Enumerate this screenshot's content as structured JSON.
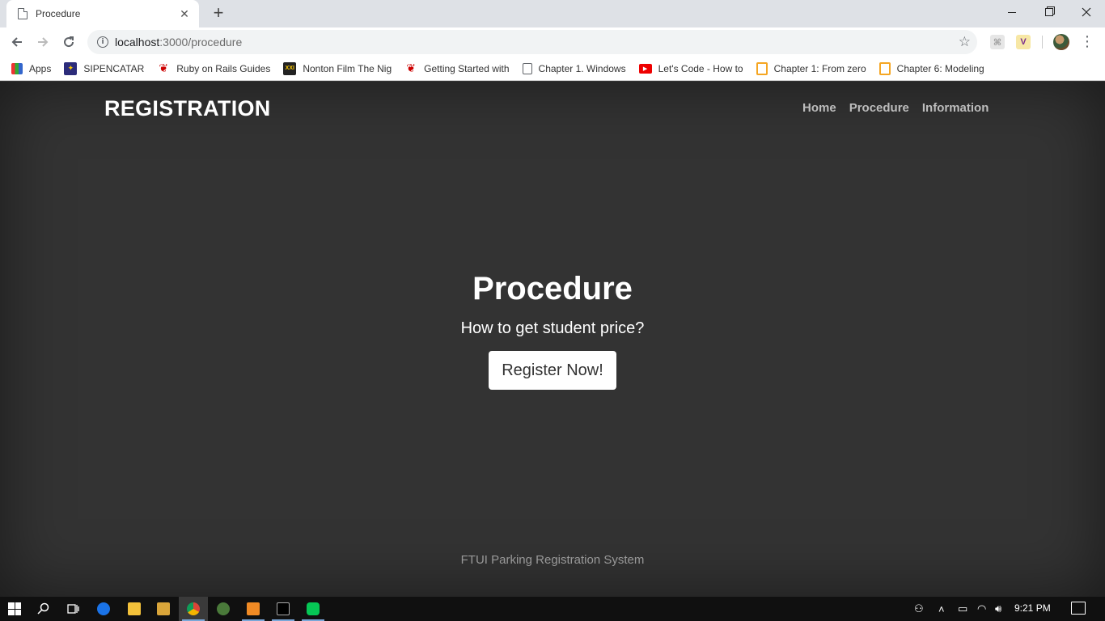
{
  "browser": {
    "tab_title": "Procedure",
    "tab_close": "✕",
    "new_tab": "+",
    "url_host": "localhost",
    "url_path": ":3000/procedure",
    "bookmarks": [
      {
        "label": "Apps",
        "icon": "apps-icon"
      },
      {
        "label": "SIPENCATAR",
        "icon": "sipencatar-icon"
      },
      {
        "label": "Ruby on Rails Guides",
        "icon": "rails-icon"
      },
      {
        "label": "Nonton Film The Nig",
        "icon": "xxi-icon"
      },
      {
        "label": "Getting Started with",
        "icon": "rails-icon"
      },
      {
        "label": "Chapter 1. Windows",
        "icon": "page-icon"
      },
      {
        "label": "Let's Code - How to",
        "icon": "youtube-icon"
      },
      {
        "label": "Chapter 1: From zero",
        "icon": "opera-icon"
      },
      {
        "label": "Chapter 6: Modeling",
        "icon": "opera-icon"
      }
    ]
  },
  "site": {
    "brand": "REGISTRATION",
    "nav": [
      "Home",
      "Procedure",
      "Information"
    ],
    "hero_title": "Procedure",
    "hero_subtitle": "How to get student price?",
    "cta_label": "Register Now!",
    "footer": "FTUI Parking Registration System"
  },
  "taskbar": {
    "clock": "9:21 PM"
  }
}
